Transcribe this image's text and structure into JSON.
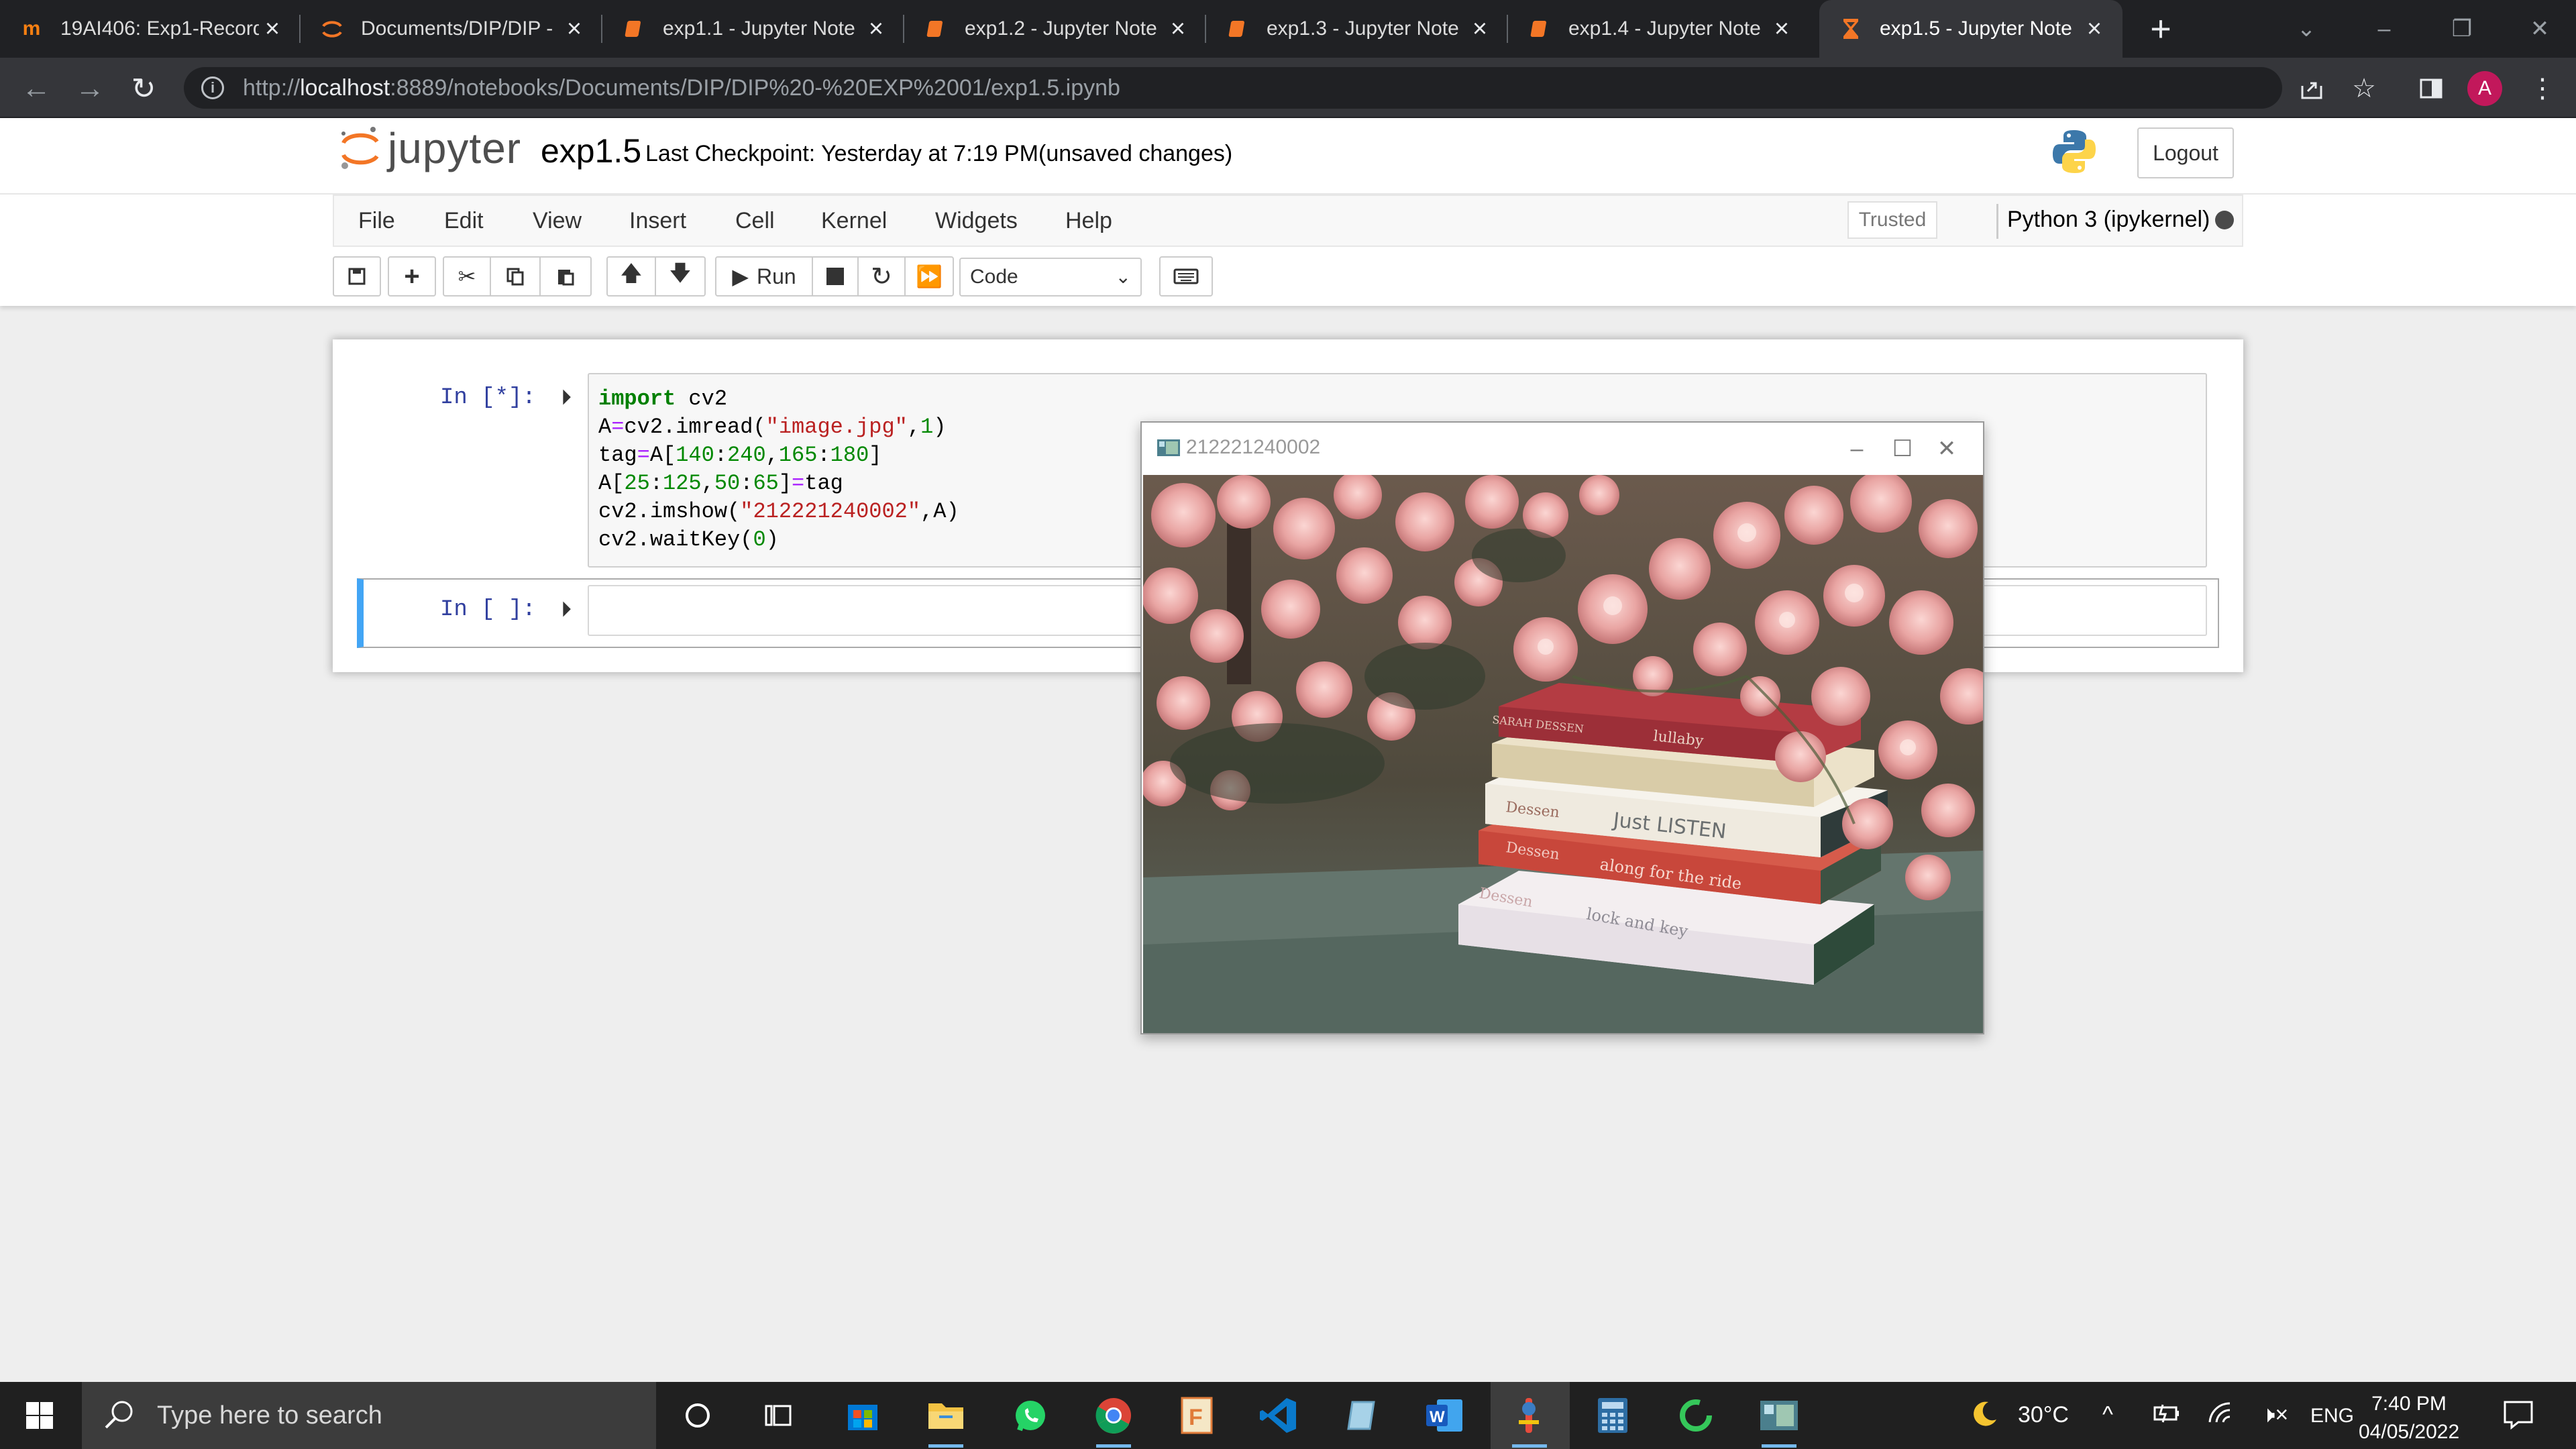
{
  "browser": {
    "tabs": [
      {
        "label": "19AI406: Exp1-Record",
        "icon": "moodle-icon"
      },
      {
        "label": "Documents/DIP/DIP - ",
        "icon": "jupyter-icon"
      },
      {
        "label": "exp1.1 - Jupyter Note",
        "icon": "notebook-icon"
      },
      {
        "label": "exp1.2 - Jupyter Note",
        "icon": "notebook-icon"
      },
      {
        "label": "exp1.3 - Jupyter Note",
        "icon": "notebook-icon"
      },
      {
        "label": "exp1.4 - Jupyter Note",
        "icon": "notebook-icon"
      },
      {
        "label": "exp1.5 - Jupyter Note",
        "icon": "hourglass-icon",
        "active": true
      }
    ],
    "url_prefix": "http://",
    "url_host": "localhost",
    "url_rest": ":8889/notebooks/Documents/DIP/DIP%20-%20EXP%2001/exp1.5.ipynb",
    "profile_initial": "A"
  },
  "jupyter": {
    "logo_text": "jupyter",
    "notebook_name": "exp1.5",
    "checkpoint": "Last Checkpoint: Yesterday at 7:19 PM",
    "unsaved": "(unsaved changes)",
    "logout_label": "Logout",
    "menu": [
      "File",
      "Edit",
      "View",
      "Insert",
      "Cell",
      "Kernel",
      "Widgets",
      "Help"
    ],
    "trusted_label": "Trusted",
    "kernel_name": "Python 3 (ipykernel)",
    "run_label": "Run",
    "cell_type": "Code"
  },
  "cells": [
    {
      "prompt": "In [*]:",
      "code_lines": [
        "import cv2",
        "A=cv2.imread(\"image.jpg\",1)",
        "tag=A[140:240,165:180]",
        "A[25:125,50:65]=tag",
        "cv2.imshow(\"212221240002\",A)",
        "cv2.waitKey(0)"
      ]
    },
    {
      "prompt": "In [ ]:",
      "code_lines": []
    }
  ],
  "image_window": {
    "title": "212221240002",
    "book_texts": [
      "lullaby",
      "Just LISTEN",
      "along for the ride",
      "lock and key",
      "Dessen",
      "Dessen",
      "Dessen",
      "SARAH DESSEN"
    ]
  },
  "taskbar": {
    "search_placeholder": "Type here to search",
    "weather": "30°C",
    "language": "ENG",
    "time": "7:40 PM",
    "date": "04/05/2022"
  },
  "colors": {
    "chrome_dark": "#202124",
    "chrome_toolbar": "#35363a",
    "jupyter_orange": "#f37626",
    "cell_selected": "#42a5f5",
    "prompt_blue": "#303f9f"
  }
}
